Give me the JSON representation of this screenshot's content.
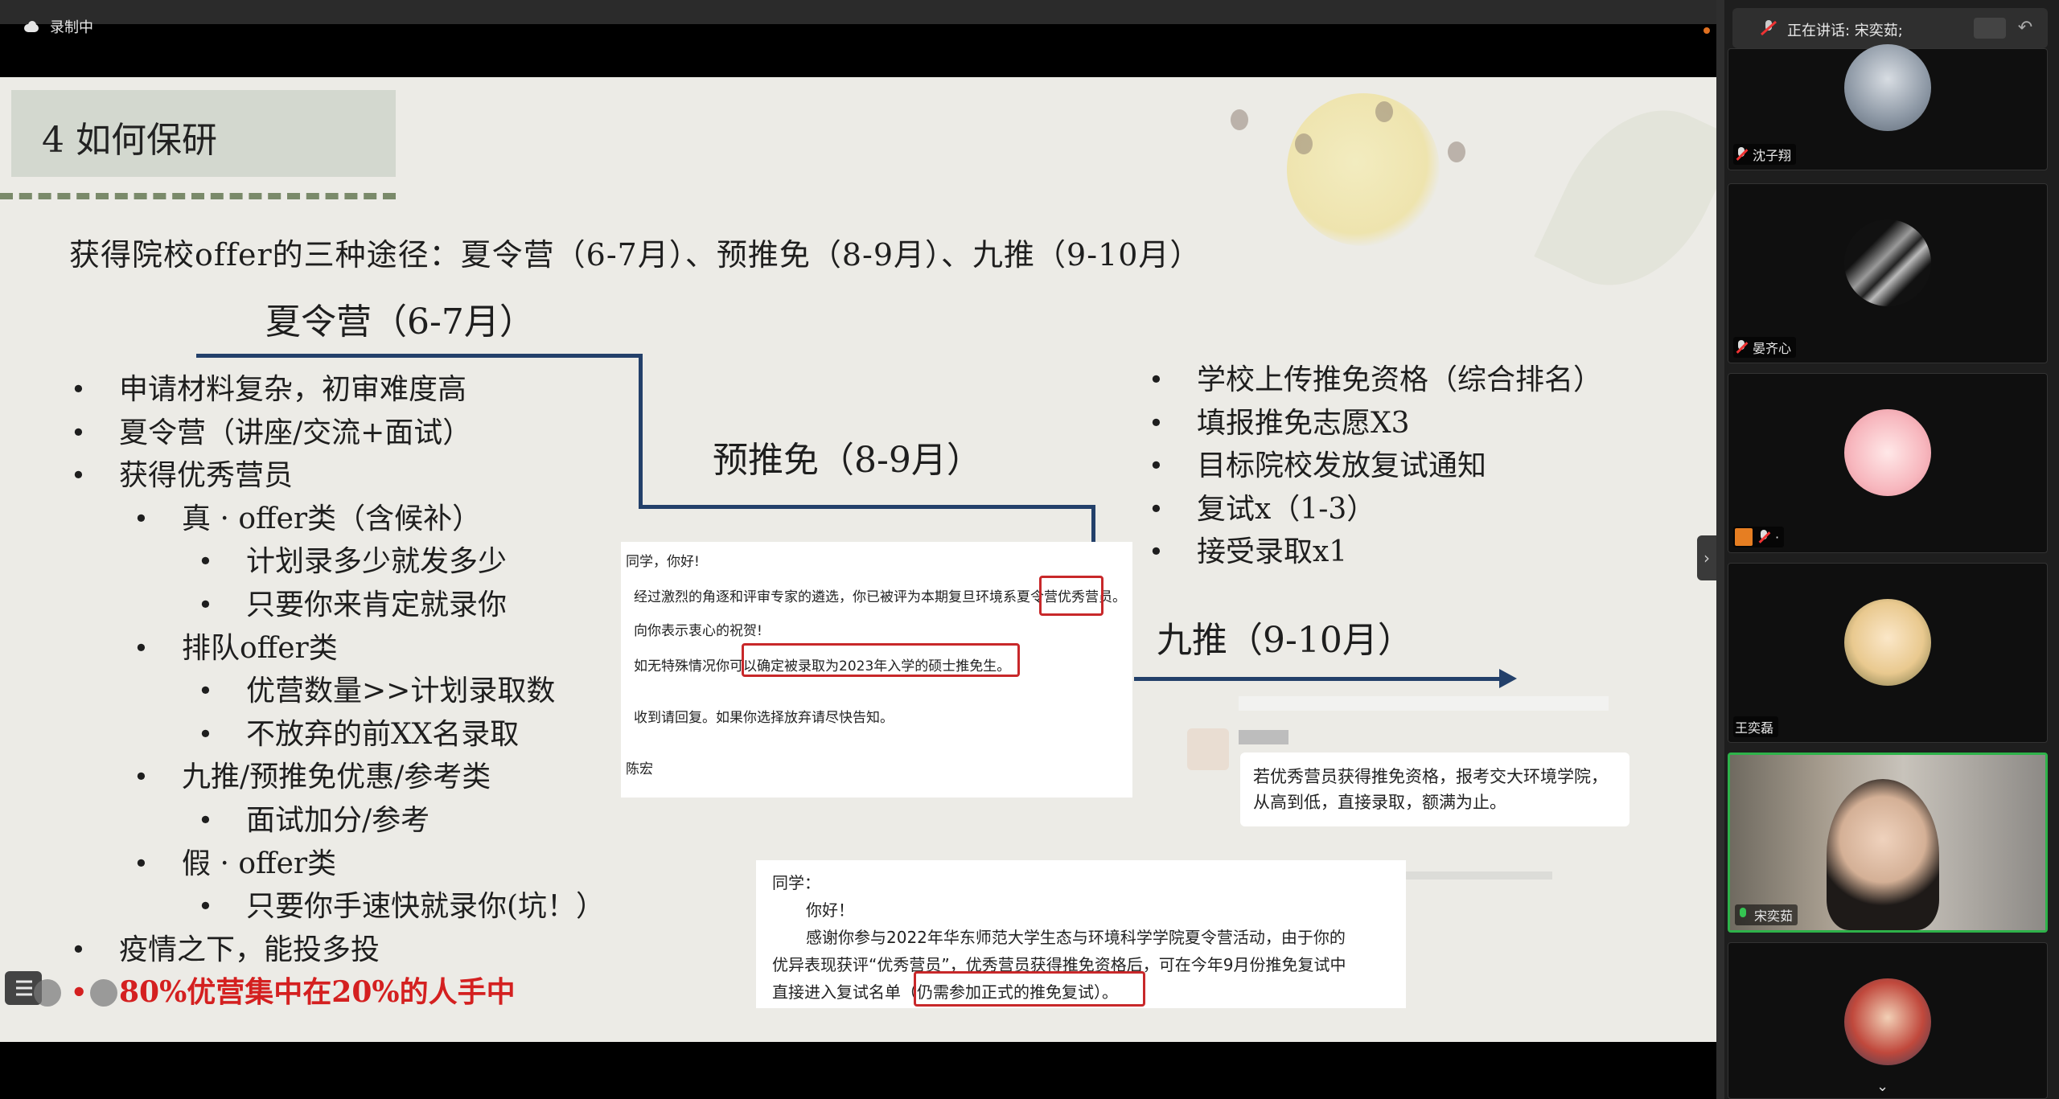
{
  "recording": {
    "label": "录制中"
  },
  "slide": {
    "title": "4  如何保研",
    "headline": "获得院校offer的三种途径：夏令营（6-7月）、预推免（8-9月）、九推（9-10月）",
    "summer": {
      "title": "夏令营（6-7月）",
      "items": [
        "申请材料复杂，初审难度高",
        "夏令营（讲座/交流+面试）",
        "获得优秀营员"
      ],
      "sub_items": [
        {
          "level": 1,
          "text": "真 · offer类（含候补）"
        },
        {
          "level": 2,
          "text": "计划录多少就发多少"
        },
        {
          "level": 2,
          "text": "只要你来肯定就录你"
        },
        {
          "level": 1,
          "text": "排队offer类"
        },
        {
          "level": 2,
          "text": "优营数量>>计划录取数"
        },
        {
          "level": 2,
          "text": "不放弃的前XX名录取"
        },
        {
          "level": 1,
          "text": "九推/预推免优惠/参考类"
        },
        {
          "level": 2,
          "text": "面试加分/参考"
        },
        {
          "level": 1,
          "text": "假 · offer类"
        },
        {
          "level": 2,
          "text": "只要你手速快就录你(坑！）"
        }
      ],
      "tail_items": [
        "疫情之下，能投多投"
      ],
      "highlight_item": "80%优营集中在20%的人手中"
    },
    "pre": {
      "title": "预推免（8-9月）"
    },
    "nine": {
      "title": "九推（9-10月）",
      "items": [
        "学校上传推免资格（综合排名）",
        "填报推免志愿X3",
        "目标院校发放复试通知",
        "复试x（1-3）",
        "接受录取x1"
      ]
    },
    "letter1": {
      "greeting": "同学，你好!",
      "line1_a": "经过激烈的角逐和评审专家的遴选，你已被评为本期复旦环境系夏令营",
      "line1_b": "优秀营员",
      "line1_c": "。",
      "line2": "向你表示衷心的祝贺!",
      "line3_a": "如无特殊情况你可以",
      "line3_b": "确定被录取为2023年入学的硕士推免生。",
      "line4": "收到请回复。如果你选择放弃请尽快告知。",
      "sign": "陈宏"
    },
    "chat": {
      "bubble_line1": "若优秀营员获得推免资格，报考交大环境学院，",
      "bubble_line2": "从高到低，直接录取，额满为止。"
    },
    "letter2": {
      "greeting": "同学：",
      "hello": "你好！",
      "line1": "感谢你参与2022年华东师范大学生态与环境科学学院夏令营活动，由于你的",
      "line2": "优异表现获评“优秀营员”，优秀营员获得推免资格后，可在今年9月份推免复试中",
      "line3_a": "直接进入复试名单",
      "line3_b": "（仍需参加正式的推免复试）",
      "line3_c": "。"
    }
  },
  "panel": {
    "speaking_label": "正在讲话: 宋奕茹;",
    "participants": [
      {
        "name": "沈子翔",
        "mic": "muted"
      },
      {
        "name": "晏齐心",
        "mic": "muted"
      },
      {
        "name": "·",
        "mic": "muted"
      },
      {
        "name": "王奕磊",
        "mic": "none"
      },
      {
        "name": "宋奕茹",
        "mic": "on"
      },
      {
        "name": "",
        "mic": "none"
      }
    ]
  },
  "colors": {
    "accent_green": "#2eb24a",
    "step_line": "#23406a",
    "highlight_red": "#c8282a"
  }
}
